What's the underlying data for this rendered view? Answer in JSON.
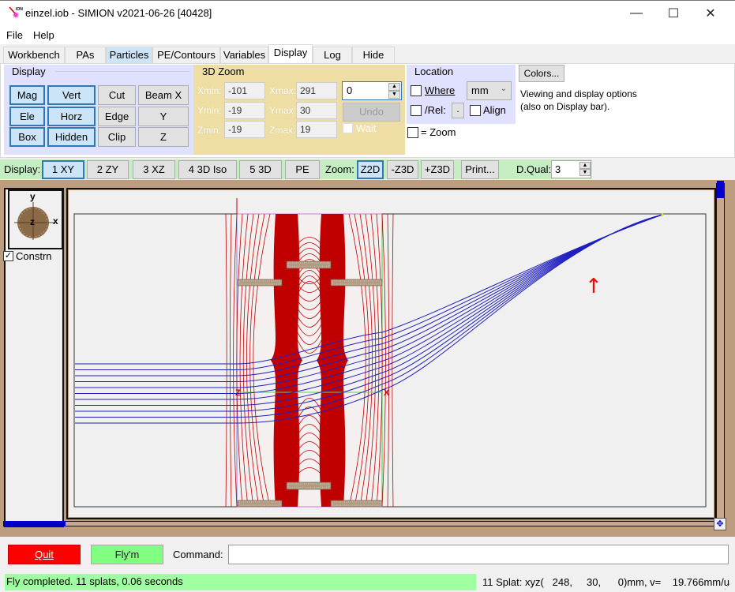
{
  "window": {
    "title": "einzel.iob - SIMION v2021-06-26 [40428]",
    "controls": [
      "minimize",
      "maximize",
      "close"
    ],
    "minimize_glyph": "—",
    "maximize_glyph": "☐",
    "close_glyph": "✕"
  },
  "menu": {
    "items": [
      "File",
      "Help"
    ]
  },
  "tabs": [
    {
      "label": "Workbench",
      "state": "normal"
    },
    {
      "label": "PAs",
      "state": "normal"
    },
    {
      "label": "Particles",
      "state": "highlighted"
    },
    {
      "label": "PE/Contours",
      "state": "normal"
    },
    {
      "label": "Variables",
      "state": "normal"
    },
    {
      "label": "Display",
      "state": "active"
    },
    {
      "label": "Log",
      "state": "normal"
    },
    {
      "label": "Hide",
      "state": "normal"
    }
  ],
  "display_group": {
    "title": "Display",
    "buttons": [
      {
        "label": "Mag",
        "on": true
      },
      {
        "label": "Vert",
        "on": true
      },
      {
        "label": "Cut",
        "on": false
      },
      {
        "label": "Beam X",
        "on": false
      },
      {
        "label": "Ele",
        "on": true
      },
      {
        "label": "Horz",
        "on": true
      },
      {
        "label": "Edge",
        "on": false
      },
      {
        "label": "Y",
        "on": false
      },
      {
        "label": "Box",
        "on": true
      },
      {
        "label": "Hidden",
        "on": true
      },
      {
        "label": "Clip",
        "on": false
      },
      {
        "label": "Z",
        "on": false
      }
    ]
  },
  "zoom3d": {
    "title": "3D Zoom",
    "xmin_label": "Xmin:",
    "xmin": "-101",
    "xmax_label": "Xmax:",
    "xmax": "291",
    "ymin_label": "Ymin:",
    "ymin": "-19",
    "ymax_label": "Ymax:",
    "ymax": "30",
    "zmin_label": "Zmin:",
    "zmin": "-19",
    "zmax_label": "Zmax:",
    "zmax": "19",
    "spin_value": "0",
    "undo_label": "Undo",
    "wait_label": "Wait",
    "wait_checked": false
  },
  "location": {
    "title": "Location",
    "where_label": "Where",
    "where_checked": false,
    "unit": "mm",
    "rel_label": "/Rel:",
    "rel_checked": false,
    "dot_label": ".",
    "align_label": "Align",
    "align_checked": false,
    "eq_zoom_label": "= Zoom",
    "eq_zoom_checked": false
  },
  "colors_button": "Colors...",
  "help_text_line1": "Viewing and display options",
  "help_text_line2": "(also on Display bar).",
  "display_bar": {
    "label": "Display:",
    "views": [
      {
        "label": "1 XY",
        "on": true
      },
      {
        "label": "2 ZY",
        "on": false
      },
      {
        "label": "3 XZ",
        "on": false
      },
      {
        "label": "4 3D Iso",
        "on": false
      },
      {
        "label": "5 3D",
        "on": false
      },
      {
        "label": "PE",
        "on": false
      }
    ],
    "zoom_label": "Zoom:",
    "zoom_buttons": [
      {
        "label": "Z2D",
        "on": true
      },
      {
        "label": "-Z3D",
        "on": false
      },
      {
        "label": "+Z3D",
        "on": false
      }
    ],
    "print_label": "Print...",
    "dqual_label": "D.Qual:",
    "dqual_value": "3"
  },
  "view": {
    "orientation": {
      "y": "y",
      "x": "x",
      "z": "z"
    },
    "constrain_label": "Constrn",
    "constrain_checked": true,
    "axis_marker_z": "Z",
    "axis_marker_x": "X",
    "annotation": "↑",
    "colors": {
      "contour": "#c00000",
      "trajectory": "#2020c0",
      "electrode": "#b09a80",
      "frame": "#bd9d80",
      "scroll_thumb": "#0000c8"
    },
    "trajectory_count": 11
  },
  "bottom": {
    "quit_label": "Quit",
    "fly_label": "Fly'm",
    "command_label": "Command:",
    "command_value": ""
  },
  "status": {
    "left": "Fly completed. 11 splats, 0.06 seconds",
    "right": "11 Splat: xyz(   248,     30,      0)mm, v=    19.766mm/u"
  }
}
